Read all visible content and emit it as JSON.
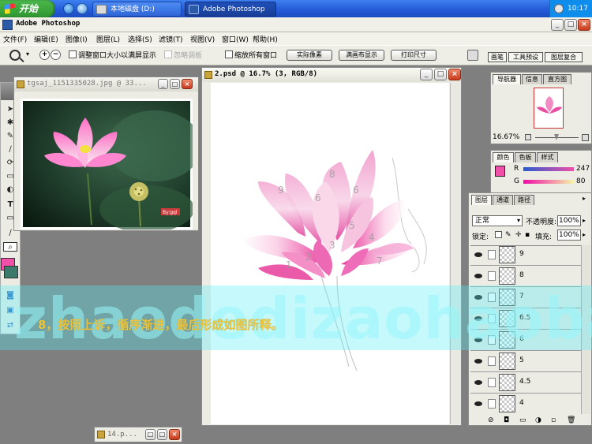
{
  "taskbar": {
    "start_label": "开始",
    "tasks": [
      {
        "label": "本地磁盘 (D:)"
      },
      {
        "label": "Adobe Photoshop"
      }
    ],
    "clock": "10:17"
  },
  "app": {
    "title": "Adobe Photoshop",
    "menu": [
      "文件(F)",
      "编辑(E)",
      "图像(I)",
      "图层(L)",
      "选择(S)",
      "滤镜(T)",
      "视图(V)",
      "窗口(W)",
      "帮助(H)"
    ]
  },
  "options": {
    "zoom_in": "+",
    "zoom_out": "−",
    "resize_window": "调整窗口大小以满屏显示",
    "ignore_palettes": "忽略调板",
    "zoom_all": "缩放所有窗口",
    "actual_pixels": "实际像素",
    "fit_on_screen": "满画布显示",
    "print_size": "打印尺寸",
    "well_tabs": [
      "画笔",
      "工具预设",
      "图层复合"
    ]
  },
  "docs": {
    "photo": {
      "title": "tgsaj_1151335028.jpg @ 33...",
      "watermark": "By:gql"
    },
    "main": {
      "title": "2.psd @ 16.7% (3, RGB/8)"
    },
    "minimized": {
      "title": "14.p..."
    }
  },
  "navigator": {
    "tabs": [
      "导航器",
      "信息",
      "直方图"
    ],
    "zoom": "16.67%"
  },
  "color": {
    "tabs": [
      "颜色",
      "色板",
      "样式"
    ],
    "channels": [
      {
        "label": "R",
        "value": "247"
      },
      {
        "label": "G",
        "value": "80"
      }
    ],
    "foreground": "#f050a8"
  },
  "layers": {
    "tabs": [
      "图层",
      "通道",
      "路径"
    ],
    "blend_mode": "正常",
    "opacity_label": "不透明度:",
    "opacity": "100%",
    "lock_label": "锁定:",
    "fill_label": "填充:",
    "fill": "100%",
    "items": [
      {
        "name": "9"
      },
      {
        "name": "8"
      },
      {
        "name": "7"
      },
      {
        "name": "6.5"
      },
      {
        "name": "6"
      },
      {
        "name": "5"
      },
      {
        "name": "4.5"
      },
      {
        "name": "4"
      }
    ]
  },
  "overlay": {
    "watermark": "zhaodedizaohaoba",
    "caption": "8，按照上诉，循序渐进，最后形成如图所释。"
  }
}
